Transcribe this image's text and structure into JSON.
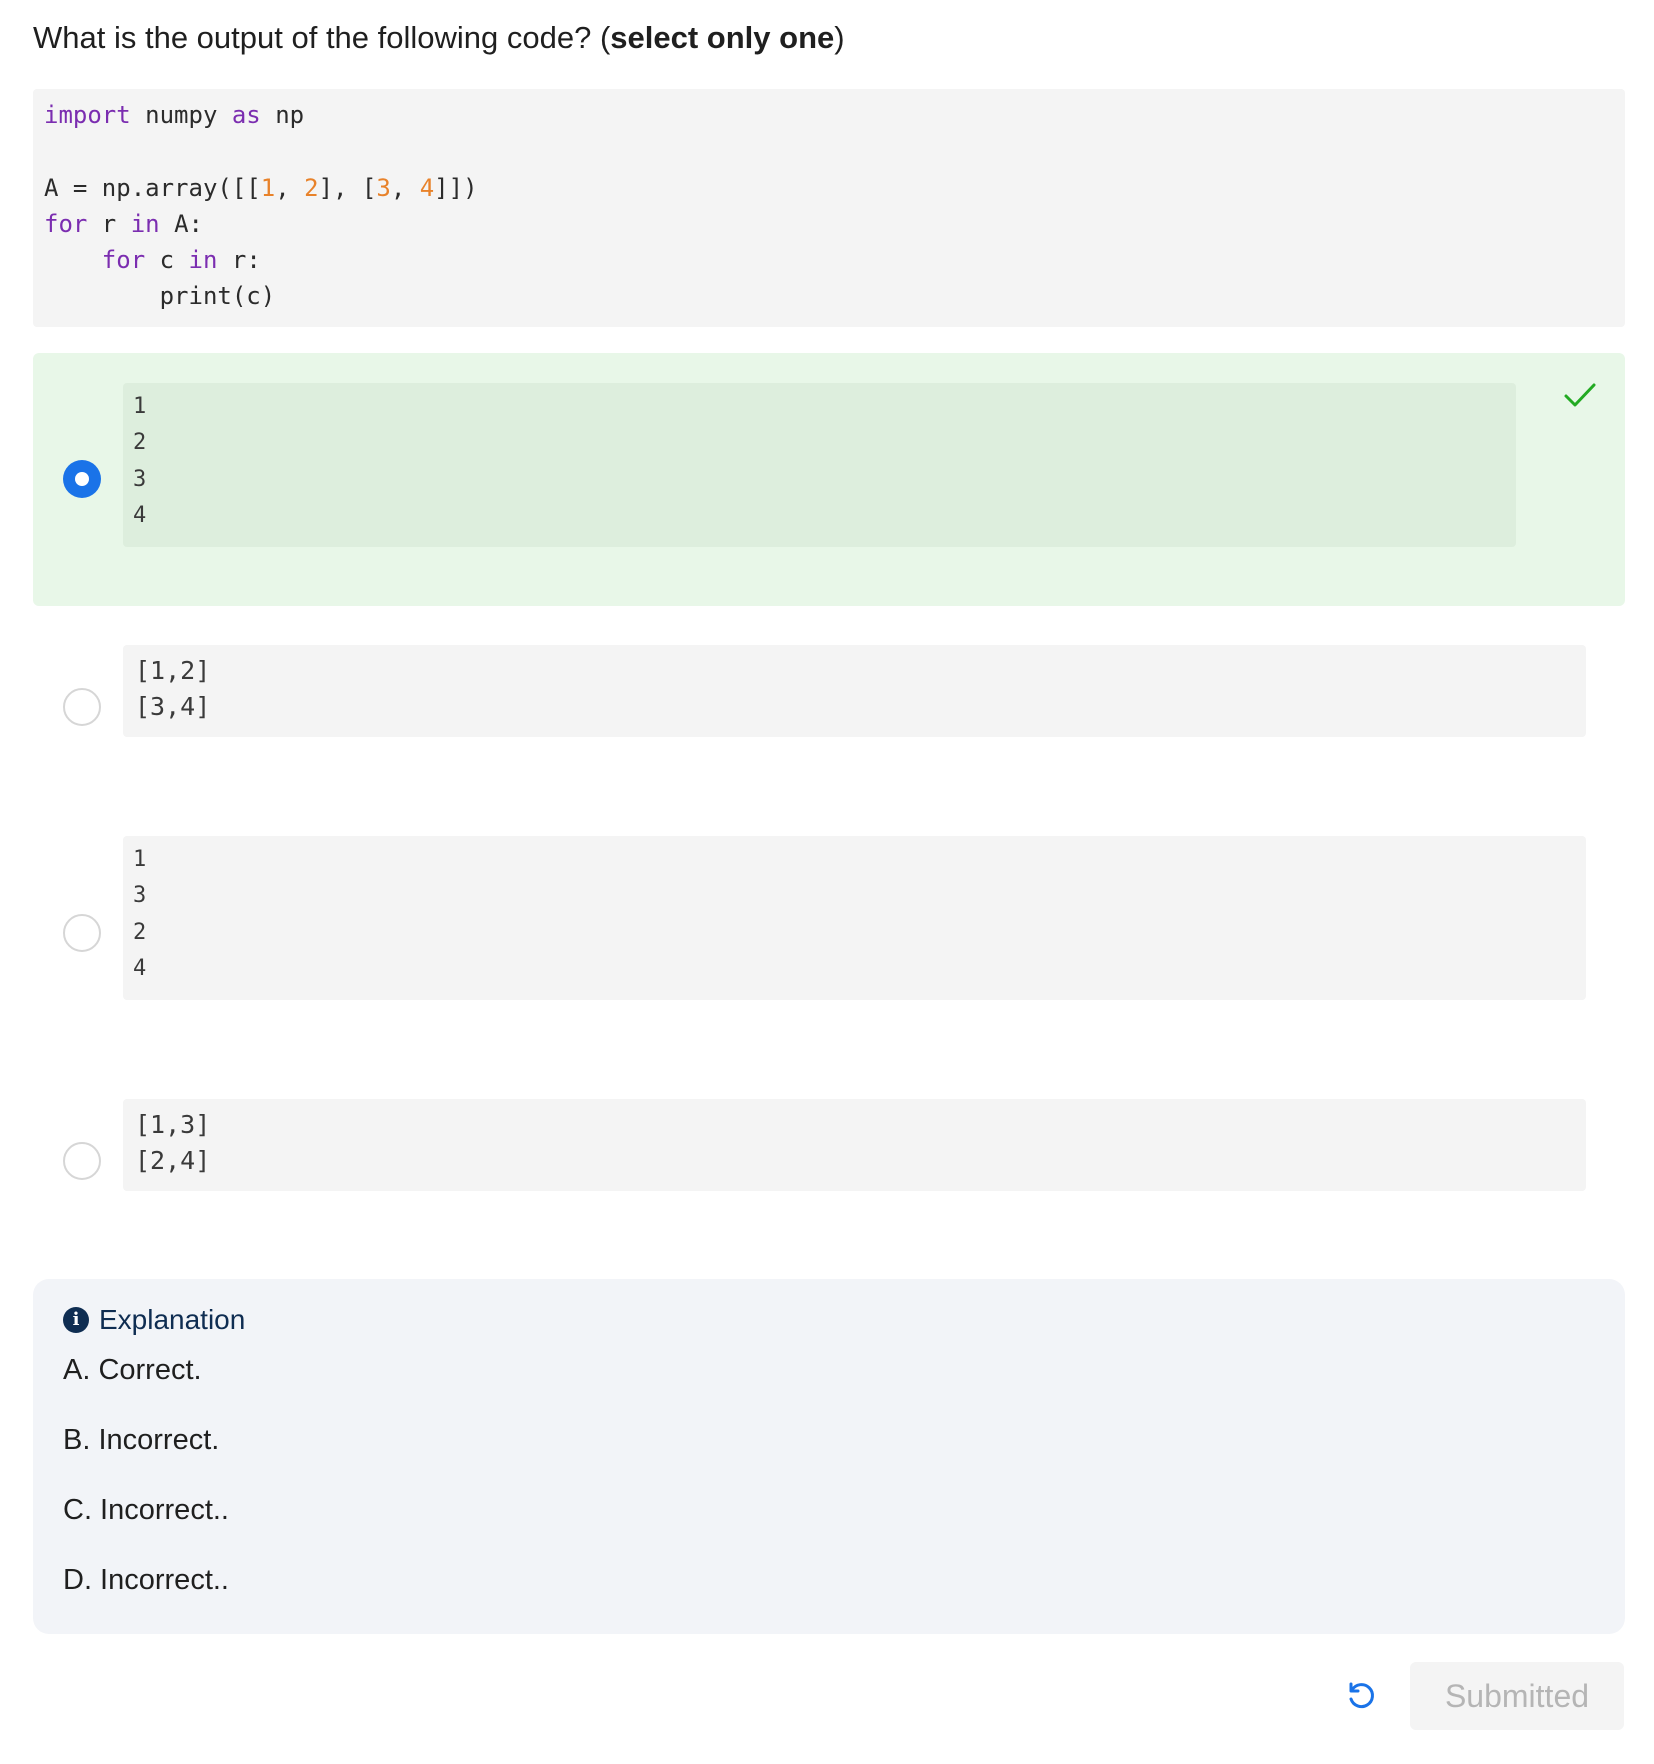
{
  "question": {
    "prefix": "What is the output of the following code? (",
    "emphasis": "select only one",
    "suffix": ")"
  },
  "code": {
    "lines": [
      "import numpy as np",
      "",
      "A = np.array([[1, 2], [3, 4]])",
      "for r in A:",
      "    for c in r:",
      "        print(c)"
    ]
  },
  "options": [
    {
      "id": "A",
      "output": "1\n2\n3\n4",
      "selected": true,
      "correct": true
    },
    {
      "id": "B",
      "output": "[1,2]\n[3,4]",
      "selected": false
    },
    {
      "id": "C",
      "output": "1\n3\n2\n4",
      "selected": false
    },
    {
      "id": "D",
      "output": "[1,3]\n[2,4]",
      "selected": false
    }
  ],
  "explanation": {
    "title": "Explanation",
    "icon": "info-icon",
    "lines": [
      "A. Correct.",
      "B. Incorrect.",
      "C. Incorrect..",
      "D. Incorrect.."
    ]
  },
  "actions": {
    "reset_icon": "reset-icon",
    "submit_label": "Submitted"
  },
  "colors": {
    "selected_bg": "#e8f7e8",
    "check": "#22aa22",
    "radio_checked": "#1a73e8",
    "explanation_title": "#0f2d52"
  }
}
